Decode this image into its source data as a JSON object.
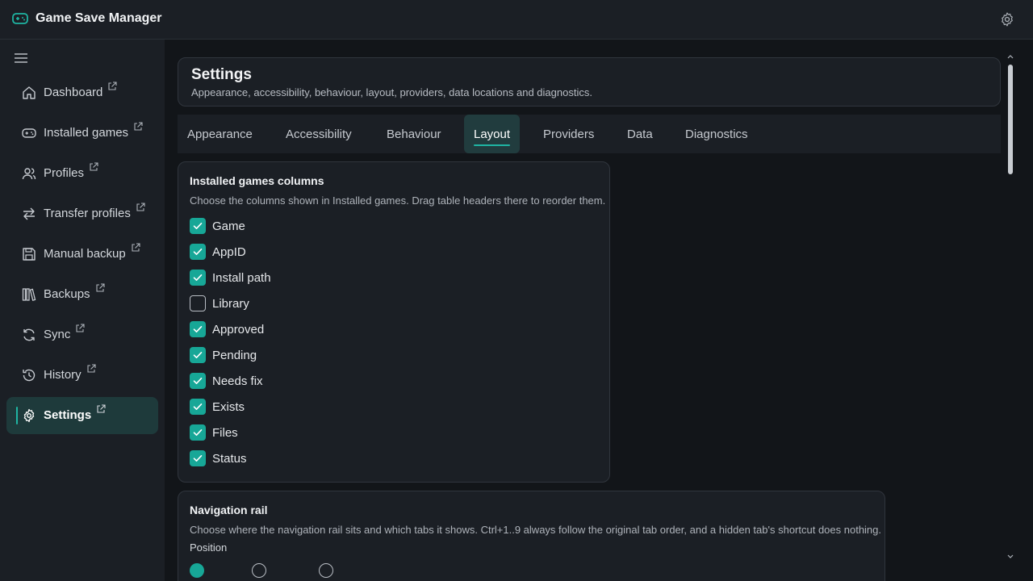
{
  "app": {
    "title": "Game Save Manager"
  },
  "sidebar": {
    "items": [
      {
        "label": "Dashboard",
        "icon": "home-icon"
      },
      {
        "label": "Installed games",
        "icon": "gamepad-icon"
      },
      {
        "label": "Profiles",
        "icon": "users-icon"
      },
      {
        "label": "Transfer profiles",
        "icon": "arrows-swap-icon"
      },
      {
        "label": "Manual backup",
        "icon": "save-icon"
      },
      {
        "label": "Backups",
        "icon": "library-icon"
      },
      {
        "label": "Sync",
        "icon": "refresh-icon"
      },
      {
        "label": "History",
        "icon": "history-icon"
      },
      {
        "label": "Settings",
        "icon": "gear-icon",
        "active": true
      }
    ]
  },
  "header": {
    "title": "Settings",
    "subtitle": "Appearance, accessibility, behaviour, layout, providers, data locations and diagnostics."
  },
  "tabs": [
    {
      "label": "Appearance"
    },
    {
      "label": "Accessibility"
    },
    {
      "label": "Behaviour"
    },
    {
      "label": "Layout",
      "active": true
    },
    {
      "label": "Providers"
    },
    {
      "label": "Data"
    },
    {
      "label": "Diagnostics"
    }
  ],
  "columns_card": {
    "title": "Installed games columns",
    "description": "Choose the columns shown in Installed games. Drag table headers there to reorder them.",
    "options": [
      {
        "label": "Game",
        "checked": true
      },
      {
        "label": "AppID",
        "checked": true
      },
      {
        "label": "Install path",
        "checked": true
      },
      {
        "label": "Library",
        "checked": false
      },
      {
        "label": "Approved",
        "checked": true
      },
      {
        "label": "Pending",
        "checked": true
      },
      {
        "label": "Needs fix",
        "checked": true
      },
      {
        "label": "Exists",
        "checked": true
      },
      {
        "label": "Files",
        "checked": true
      },
      {
        "label": "Status",
        "checked": true
      }
    ]
  },
  "nav_rail_card": {
    "title": "Navigation rail",
    "description": "Choose where the navigation rail sits and which tabs it shows. Ctrl+1..9 always follow the original tab order, and a hidden tab's shortcut does nothing.",
    "position_label": "Position"
  },
  "colors": {
    "accent": "#17a797",
    "background": "#121519",
    "panel": "#1b1f25"
  }
}
